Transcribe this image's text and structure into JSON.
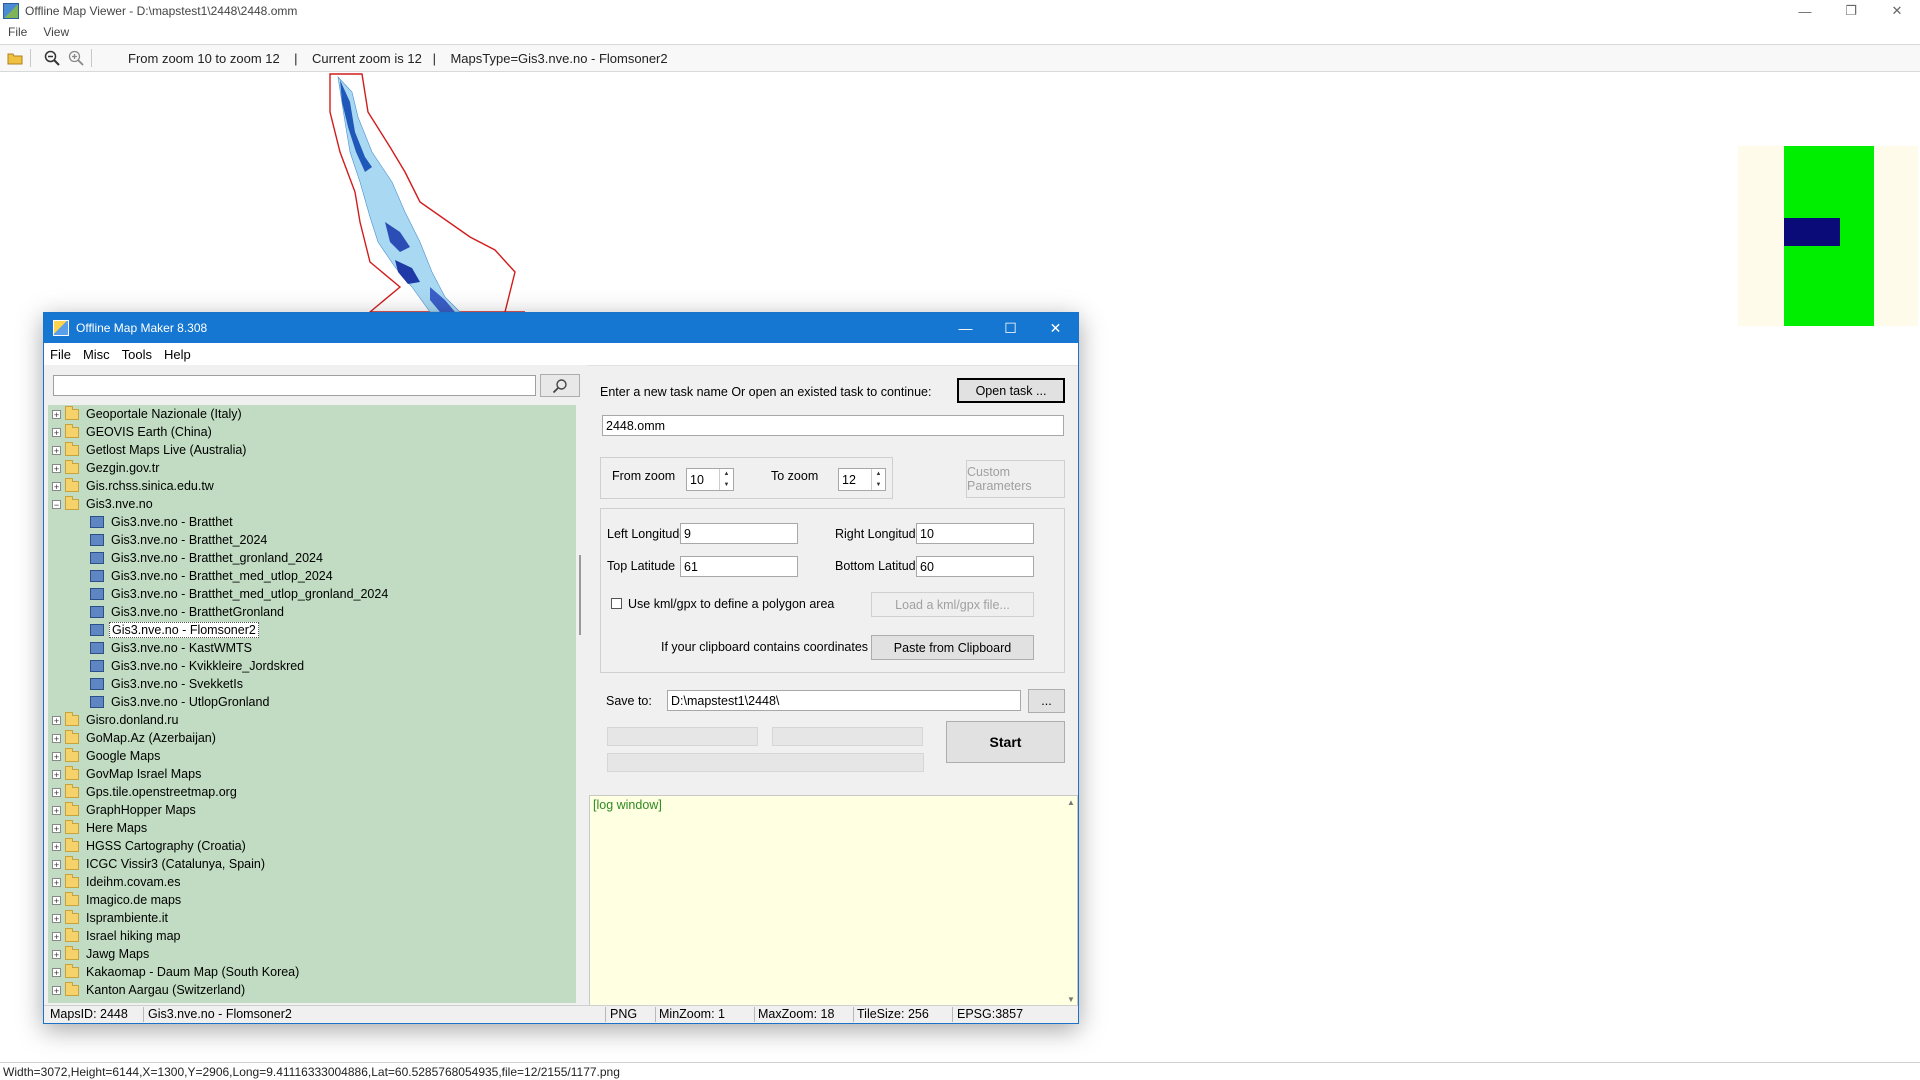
{
  "viewer": {
    "title": "Offline Map Viewer - D:\\mapstest1\\2448\\2448.omm",
    "menu": [
      "File",
      "View"
    ],
    "toolbar_info": "From zoom 10 to zoom 12    |    Current zoom is 12   |    MapsType=Gis3.nve.no - Flomsoner2",
    "status": "Width=3072,Height=6144,X=1300,Y=2906,Long=9.41116333004886,Lat=60.5285768054935,file=12/2155/1177.png"
  },
  "dialog": {
    "title": "Offline Map Maker 8.308",
    "menu": [
      "File",
      "Misc",
      "Tools",
      "Help"
    ],
    "search": {
      "value": "",
      "placeholder": ""
    },
    "tree": [
      {
        "label": "Geoportale Nazionale (Italy)",
        "type": "folder",
        "expanded": false
      },
      {
        "label": "GEOVIS Earth (China)",
        "type": "folder",
        "expanded": false
      },
      {
        "label": "Getlost Maps Live (Australia)",
        "type": "folder",
        "expanded": false
      },
      {
        "label": "Gezgin.gov.tr",
        "type": "folder",
        "expanded": false
      },
      {
        "label": "Gis.rchss.sinica.edu.tw",
        "type": "folder",
        "expanded": false
      },
      {
        "label": "Gis3.nve.no",
        "type": "folder",
        "expanded": true
      },
      {
        "label": "Gis3.nve.no - Bratthet",
        "type": "map"
      },
      {
        "label": "Gis3.nve.no - Bratthet_2024",
        "type": "map"
      },
      {
        "label": "Gis3.nve.no - Bratthet_gronland_2024",
        "type": "map"
      },
      {
        "label": "Gis3.nve.no - Bratthet_med_utlop_2024",
        "type": "map"
      },
      {
        "label": "Gis3.nve.no - Bratthet_med_utlop_gronland_2024",
        "type": "map"
      },
      {
        "label": "Gis3.nve.no - BratthetGronland",
        "type": "map"
      },
      {
        "label": "Gis3.nve.no - Flomsoner2",
        "type": "map",
        "selected": true
      },
      {
        "label": "Gis3.nve.no - KastWMTS",
        "type": "map"
      },
      {
        "label": "Gis3.nve.no - Kvikkleire_Jordskred",
        "type": "map"
      },
      {
        "label": "Gis3.nve.no - SvekketIs",
        "type": "map"
      },
      {
        "label": "Gis3.nve.no - UtlopGronland",
        "type": "map"
      },
      {
        "label": "Gisro.donland.ru",
        "type": "folder",
        "expanded": false
      },
      {
        "label": "GoMap.Az (Azerbaijan)",
        "type": "folder",
        "expanded": false
      },
      {
        "label": "Google Maps",
        "type": "folder",
        "expanded": false
      },
      {
        "label": "GovMap Israel Maps",
        "type": "folder",
        "expanded": false
      },
      {
        "label": "Gps.tile.openstreetmap.org",
        "type": "folder",
        "expanded": false
      },
      {
        "label": "GraphHopper Maps",
        "type": "folder",
        "expanded": false
      },
      {
        "label": "Here Maps",
        "type": "folder",
        "expanded": false
      },
      {
        "label": "HGSS Cartography (Croatia)",
        "type": "folder",
        "expanded": false
      },
      {
        "label": "ICGC Vissir3 (Catalunya, Spain)",
        "type": "folder",
        "expanded": false
      },
      {
        "label": "Ideihm.covam.es",
        "type": "folder",
        "expanded": false
      },
      {
        "label": "Imagico.de maps",
        "type": "folder",
        "expanded": false
      },
      {
        "label": "Isprambiente.it",
        "type": "folder",
        "expanded": false
      },
      {
        "label": "Israel hiking map",
        "type": "folder",
        "expanded": false
      },
      {
        "label": "Jawg Maps",
        "type": "folder",
        "expanded": false
      },
      {
        "label": "Kakaomap - Daum Map (South Korea)",
        "type": "folder",
        "expanded": false
      },
      {
        "label": "Kanton Aargau (Switzerland)",
        "type": "folder",
        "expanded": false
      }
    ],
    "task": {
      "prompt": "Enter a new task name Or open an existed task to continue:",
      "open_button": "Open task ...",
      "name": "2448.omm"
    },
    "zoom": {
      "from_label": "From zoom",
      "from_value": "10",
      "to_label": "To zoom",
      "to_value": "12",
      "custom_button": "Custom Parameters"
    },
    "coords": {
      "left_label": "Left Longitude",
      "left_value": "9",
      "right_label": "Right Longitude",
      "right_value": "10",
      "top_label": "Top Latitude",
      "top_value": "61",
      "bottom_label": "Bottom Latitude",
      "bottom_value": "60",
      "kml_checkbox": "Use kml/gpx to define a polygon area",
      "kml_checked": false,
      "kml_button": "Load a kml/gpx file...",
      "clipboard_label": "If your clipboard contains coordinates values:",
      "clipboard_button": "Paste from Clipboard"
    },
    "save": {
      "label": "Save to:",
      "path": "D:\\mapstest1\\2448\\",
      "browse_button": "..."
    },
    "start_button": "Start",
    "log": "[log window]",
    "status": {
      "maps_id": "MapsID: 2448",
      "map_name": "Gis3.nve.no - Flomsoner2",
      "format": "PNG",
      "min_zoom": "MinZoom: 1",
      "max_zoom": "MaxZoom: 18",
      "tile_size": "TileSize: 256",
      "epsg": "EPSG:3857"
    }
  },
  "colors": {
    "tree_bg": "#c1dcc2",
    "title_blue": "#1677d2",
    "log_bg": "#ffffe1",
    "log_text": "#2e8b22",
    "minimap_green": "#00ee00",
    "minimap_blue": "#0a0a78"
  }
}
